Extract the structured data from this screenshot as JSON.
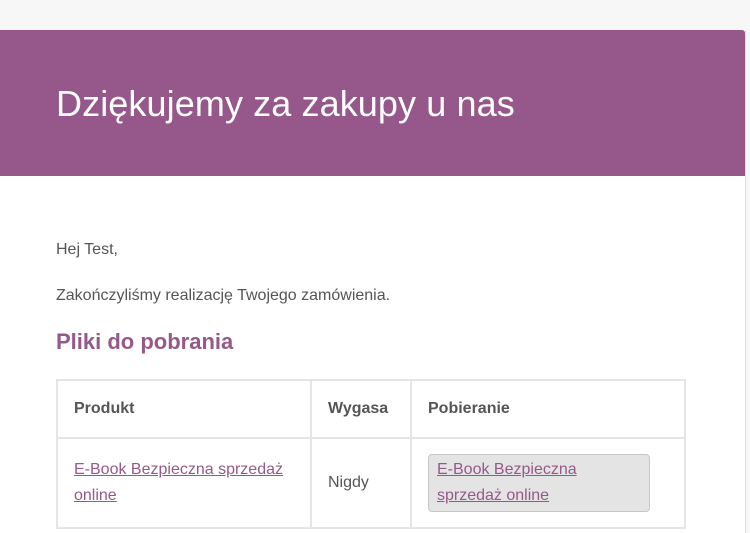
{
  "header": {
    "title": "Dziękujemy za zakupy u nas"
  },
  "body": {
    "greeting": "Hej Test,",
    "message": "Zakończyliśmy realizację Twojego zamówienia.",
    "downloads_heading": "Pliki do pobrania"
  },
  "downloads_table": {
    "columns": [
      "Produkt",
      "Wygasa",
      "Pobieranie"
    ],
    "rows": [
      {
        "product": "E-Book Bezpieczna sprzedaż online",
        "expires": "Nigdy",
        "download": "E-Book Bezpieczna sprzedaż online"
      }
    ]
  },
  "colors": {
    "accent": "#96588a",
    "text": "#555555",
    "border": "#e5e5e5",
    "page_background": "#f7f7f7"
  }
}
